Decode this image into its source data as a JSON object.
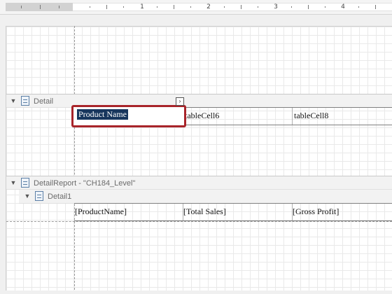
{
  "ruler": {
    "numbers": [
      "1",
      "2",
      "3",
      "4"
    ]
  },
  "bands": {
    "detail": {
      "label": "Detail",
      "toggle_icon": "collapse-triangle"
    },
    "detail_report": {
      "label": "DetailReport - \"CH184_Level\"",
      "toggle_icon": "collapse-triangle"
    },
    "detail1": {
      "label": "Detail1",
      "toggle_icon": "collapse-triangle"
    }
  },
  "detail_table": {
    "cells": [
      "Product Name",
      "tableCell6",
      "tableCell8"
    ]
  },
  "detail1_table": {
    "cells": [
      "[ProductName]",
      "[Total Sales]",
      "[Gross Profit]"
    ]
  },
  "smart_tag": {
    "glyph": "›"
  },
  "colors": {
    "selection_border": "#a8242a",
    "selection_fill": "#17365d",
    "band_icon": "#5b7fa6"
  }
}
